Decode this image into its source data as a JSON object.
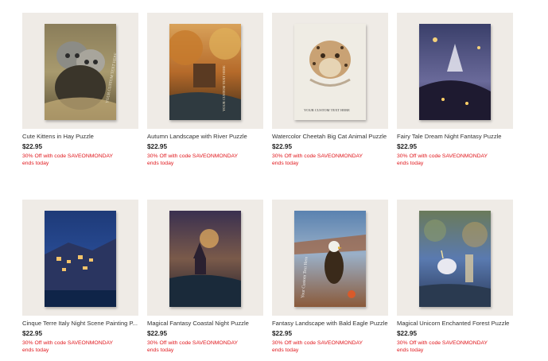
{
  "products": [
    {
      "title": "Cute Kittens in Hay Puzzle",
      "price": "$22.95",
      "promo": "30% Off with code SAVEONMONDAY",
      "ends": "ends today",
      "overlay_text": "YOUR CUSTOM TEXT HERE"
    },
    {
      "title": "Autumn Landscape with River Puzzle",
      "price": "$22.95",
      "promo": "30% Off with code SAVEONMONDAY",
      "ends": "ends today",
      "overlay_text": "YOUR CUSTOM TEXT HERE"
    },
    {
      "title": "Watercolor Cheetah Big Cat Animal Puzzle",
      "price": "$22.95",
      "promo": "30% Off with code SAVEONMONDAY",
      "ends": "ends today",
      "overlay_text": "YOUR CUSTOM TEXT HERE"
    },
    {
      "title": "Fairy Tale Dream Night Fantasy Puzzle",
      "price": "$22.95",
      "promo": "30% Off with code SAVEONMONDAY",
      "ends": "ends today"
    },
    {
      "title": "Cinque Terre Italy Night Scene Painting P...",
      "price": "$22.95",
      "promo": "30% Off with code SAVEONMONDAY",
      "ends": "ends today"
    },
    {
      "title": "Magical Fantasy Coastal Night Puzzle",
      "price": "$22.95",
      "promo": "30% Off with code SAVEONMONDAY",
      "ends": "ends today"
    },
    {
      "title": "Fantasy Landscape with Bald Eagle Puzzle",
      "price": "$22.95",
      "promo": "30% Off with code SAVEONMONDAY",
      "ends": "ends today",
      "overlay_text": "Your Custom Text Here"
    },
    {
      "title": "Magical Unicorn Enchanted Forest Puzzle",
      "price": "$22.95",
      "promo": "30% Off with code SAVEONMONDAY",
      "ends": "ends today"
    }
  ]
}
